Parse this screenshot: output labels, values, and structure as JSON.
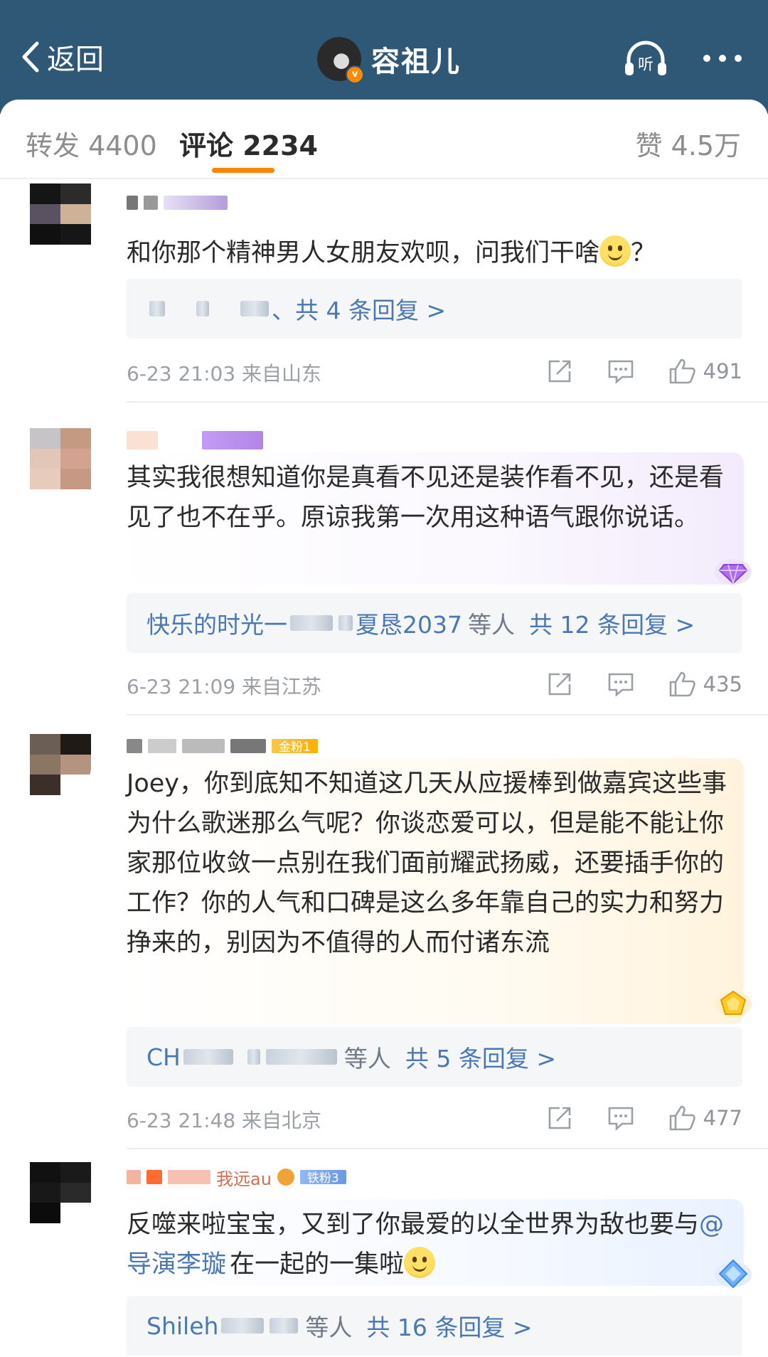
{
  "header": {
    "back_label": "返回",
    "title": "容祖儿",
    "listen_label": "听",
    "bg_color": "#2f5876"
  },
  "tabs": {
    "repost": "转发 4400",
    "comment": "评论 2234",
    "like": "赞 4.5万",
    "active_color": "#ff8200"
  },
  "comments": [
    {
      "text": "和你那个精神男人女朋友欢呗，问我们干啥",
      "text_tail": "？",
      "reply_summary": "、共 4 条回复 >",
      "time_location": "6-23 21:03 来自山东",
      "likes": "491"
    },
    {
      "text": "其实我很想知道你是真看不见还是装作看不见，还是看见了也不在乎。原谅我第一次用这种语气跟你说话。",
      "reply_prefix": "快乐的时光一",
      "reply_mid": "夏恳2037",
      "reply_others": "等人",
      "reply_count": "共 12 条回复 >",
      "time_location": "6-23 21:09 来自江苏",
      "likes": "435"
    },
    {
      "fan_badge": "金粉1",
      "text": "Joey，你到底知不知道这几天从应援棒到做嘉宾这些事为什么歌迷那么气呢？你谈恋爱可以，但是能不能让你家那位收敛一点别在我们面前耀武扬威，还要插手你的工作？你的人气和口碑是这么多年靠自己的实力和努力挣来的，别因为不值得的人而付诸东流",
      "reply_prefix": "CH",
      "reply_others": "等人",
      "reply_count": "共 5 条回复 >",
      "time_location": "6-23 21:48 来自北京",
      "likes": "477"
    },
    {
      "fan_badge": "铁粉3",
      "name_fragment": "我远au",
      "text_a": "反噬来啦宝宝，又到了你最爱的以全世界为敌也要与",
      "mention": "@导演李璇",
      "text_b": "在一起的一集啦",
      "reply_prefix": "Shileh",
      "reply_others": "等人",
      "reply_count": "共 16 条回复 >"
    }
  ]
}
